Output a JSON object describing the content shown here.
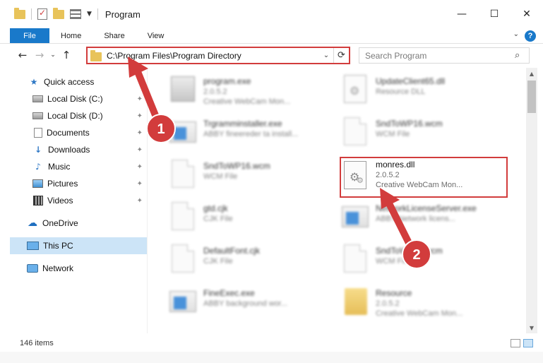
{
  "window": {
    "title": "Program",
    "minimize": "—",
    "maximize": "☐",
    "close": "✕"
  },
  "ribbon": {
    "tabs": [
      {
        "label": "File"
      },
      {
        "label": "Home"
      },
      {
        "label": "Share"
      },
      {
        "label": "View"
      }
    ],
    "help": "?",
    "collapse": "⌄"
  },
  "nav": {
    "back": "←",
    "forward": "→",
    "recent": "⌄",
    "up": "↑",
    "address": "C:\\Program Files\\Program Directory",
    "address_dropdown": "⌄",
    "refresh": "⟳",
    "search_placeholder": "Search Program",
    "search_icon": "⌕"
  },
  "sidebar": {
    "items": [
      {
        "label": "Quick access",
        "icon": "star-icon"
      },
      {
        "label": "Local Disk (C:)",
        "icon": "disk-icon",
        "pinned": true
      },
      {
        "label": "Local Disk (D:)",
        "icon": "disk-icon",
        "pinned": true
      },
      {
        "label": "Documents",
        "icon": "documents-icon",
        "pinned": true
      },
      {
        "label": "Downloads",
        "icon": "downloads-icon",
        "pinned": true
      },
      {
        "label": "Music",
        "icon": "music-icon",
        "pinned": true
      },
      {
        "label": "Pictures",
        "icon": "pictures-icon",
        "pinned": true
      },
      {
        "label": "Videos",
        "icon": "videos-icon",
        "pinned": true
      },
      {
        "label": "OneDrive",
        "icon": "cloud-icon"
      },
      {
        "label": "This PC",
        "icon": "pc-icon",
        "selected": true
      },
      {
        "label": "Network",
        "icon": "network-icon"
      }
    ],
    "pin_glyph": "📌"
  },
  "files": {
    "items": [
      {
        "name": "program.exe",
        "line2": "2.0.5.2",
        "line3": "Creative WebCam Mon...",
        "icon": "exe-icon",
        "blurred": true
      },
      {
        "name": "UpdateClient65.dll",
        "line2": "Resource DLL",
        "line3": "",
        "icon": "dll-icon",
        "blurred": true
      },
      {
        "name": "Trgramminstaller.exe",
        "line2": "ABBY fineereder ta install...",
        "line3": "",
        "icon": "app-icon",
        "blurred": true
      },
      {
        "name": "SndToWP16.wcm",
        "line2": "WCM File",
        "line3": "",
        "icon": "file-icon",
        "blurred": true
      },
      {
        "name": "SndToWP16.wcm",
        "line2": "WCM File",
        "line3": "",
        "icon": "file-icon",
        "blurred": true
      },
      {
        "name": "monres.dll",
        "line2": "2.0.5.2",
        "line3": "Creative WebCam Mon...",
        "icon": "dll-icon",
        "blurred": false
      },
      {
        "name": "gtd.cjk",
        "line2": "CJK File",
        "line3": "",
        "icon": "file-icon",
        "blurred": true
      },
      {
        "name": "NetworkLicenseServer.exe",
        "line2": "ABBY Network licens...",
        "line3": "",
        "icon": "app-icon",
        "blurred": true
      },
      {
        "name": "DefaultFont.cjk",
        "line2": "CJK File",
        "line3": "",
        "icon": "file-icon",
        "blurred": true
      },
      {
        "name": "SndToWP16.wcm",
        "line2": "WCM File",
        "line3": "",
        "icon": "file-icon",
        "blurred": true
      },
      {
        "name": "FineExec.exe",
        "line2": "ABBY background wor...",
        "line3": "",
        "icon": "app-icon",
        "blurred": true
      },
      {
        "name": "Resource",
        "line2": "2.0.5.2",
        "line3": "Creative WebCam Mon...",
        "icon": "folder-icon",
        "blurred": true
      }
    ]
  },
  "status": {
    "count": "146 items"
  },
  "annotations": {
    "step1": "1",
    "step2": "2",
    "accent": "#d23c3c"
  }
}
